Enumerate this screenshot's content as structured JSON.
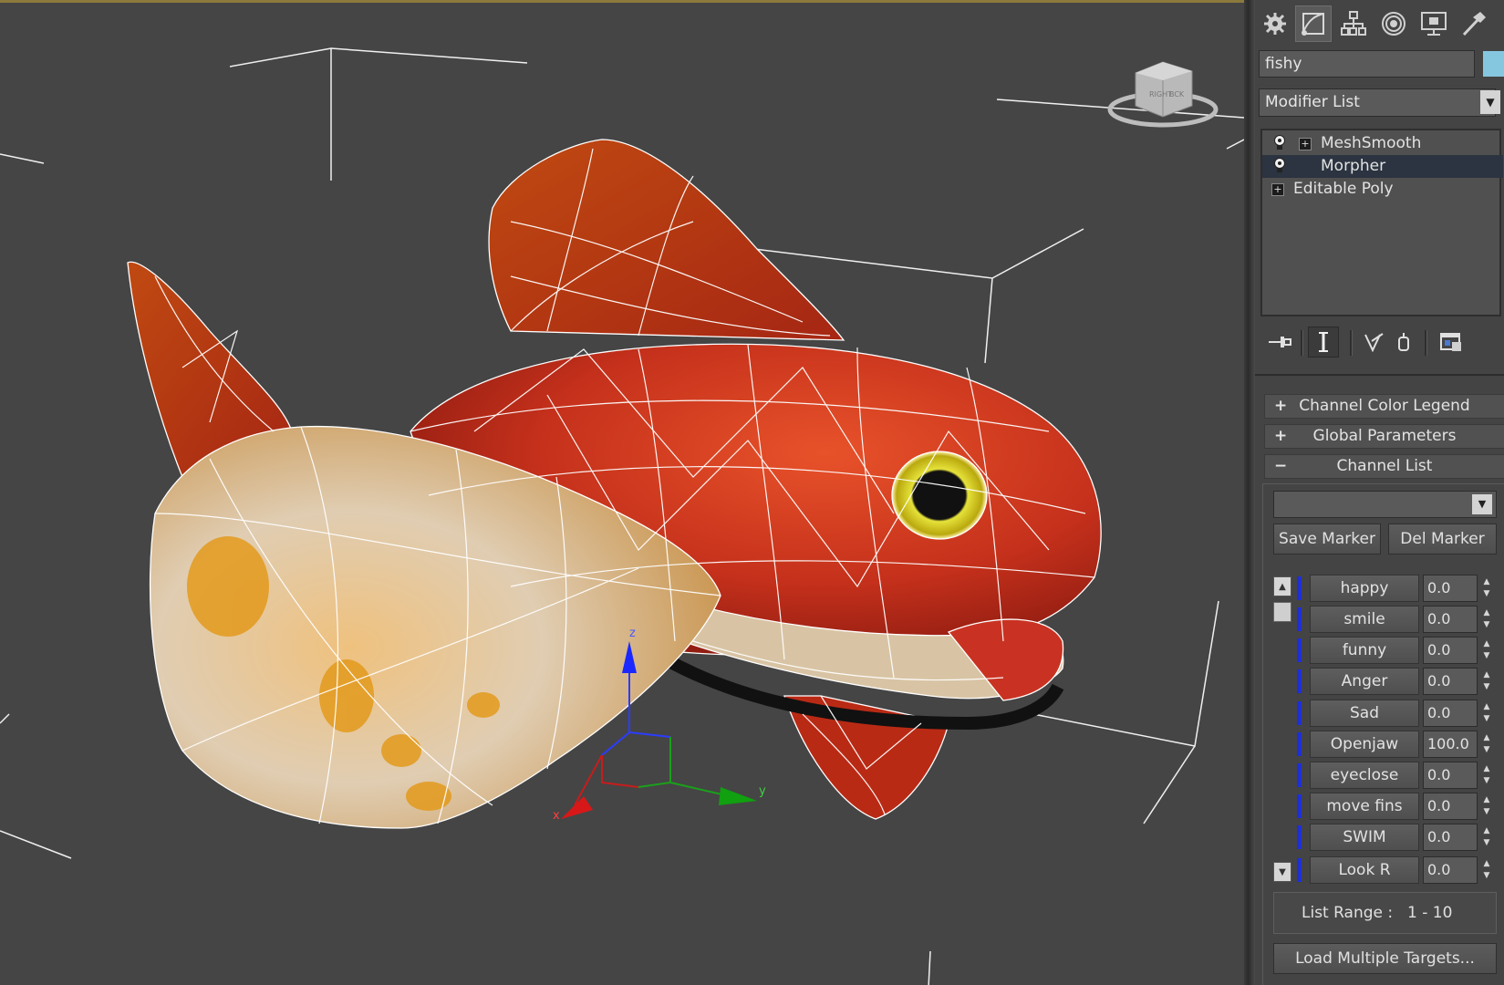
{
  "object_name": "fishy",
  "modifier_list_label": "Modifier List",
  "stack": [
    {
      "label": "MeshSmooth"
    },
    {
      "label": "Morpher"
    },
    {
      "label": "Editable Poly"
    }
  ],
  "rollouts": [
    {
      "sign": "+",
      "label": "Channel Color Legend"
    },
    {
      "sign": "+",
      "label": "Global Parameters"
    },
    {
      "sign": "−",
      "label": "Channel List"
    }
  ],
  "buttons": {
    "save_marker": "Save Marker",
    "del_marker": "Del Marker",
    "load_multiple": "Load Multiple Targets..."
  },
  "channels": [
    {
      "name": "happy",
      "value": "0.0"
    },
    {
      "name": "smile",
      "value": "0.0"
    },
    {
      "name": "funny",
      "value": "0.0"
    },
    {
      "name": "Anger",
      "value": "0.0"
    },
    {
      "name": "Sad",
      "value": "0.0"
    },
    {
      "name": "Openjaw",
      "value": "100.0"
    },
    {
      "name": "eyeclose",
      "value": "0.0"
    },
    {
      "name": "move fins",
      "value": "0.0"
    },
    {
      "name": "SWIM",
      "value": "0.0"
    },
    {
      "name": "Look R",
      "value": "0.0"
    }
  ],
  "list_range": {
    "label": "List Range :",
    "value": "1 - 10"
  },
  "viewcube": {
    "left": "RIGHT",
    "right": "BCK"
  },
  "gizmo": {
    "x": "x",
    "y": "y",
    "z": "z"
  },
  "colors": {
    "accent_blue": "#1f2fd6",
    "object_color": "#86c7e0",
    "viewport_bg": "#454545"
  },
  "command_tabs": [
    "create-icon",
    "modify-icon",
    "hierarchy-icon",
    "motion-icon",
    "display-icon",
    "utilities-icon"
  ]
}
